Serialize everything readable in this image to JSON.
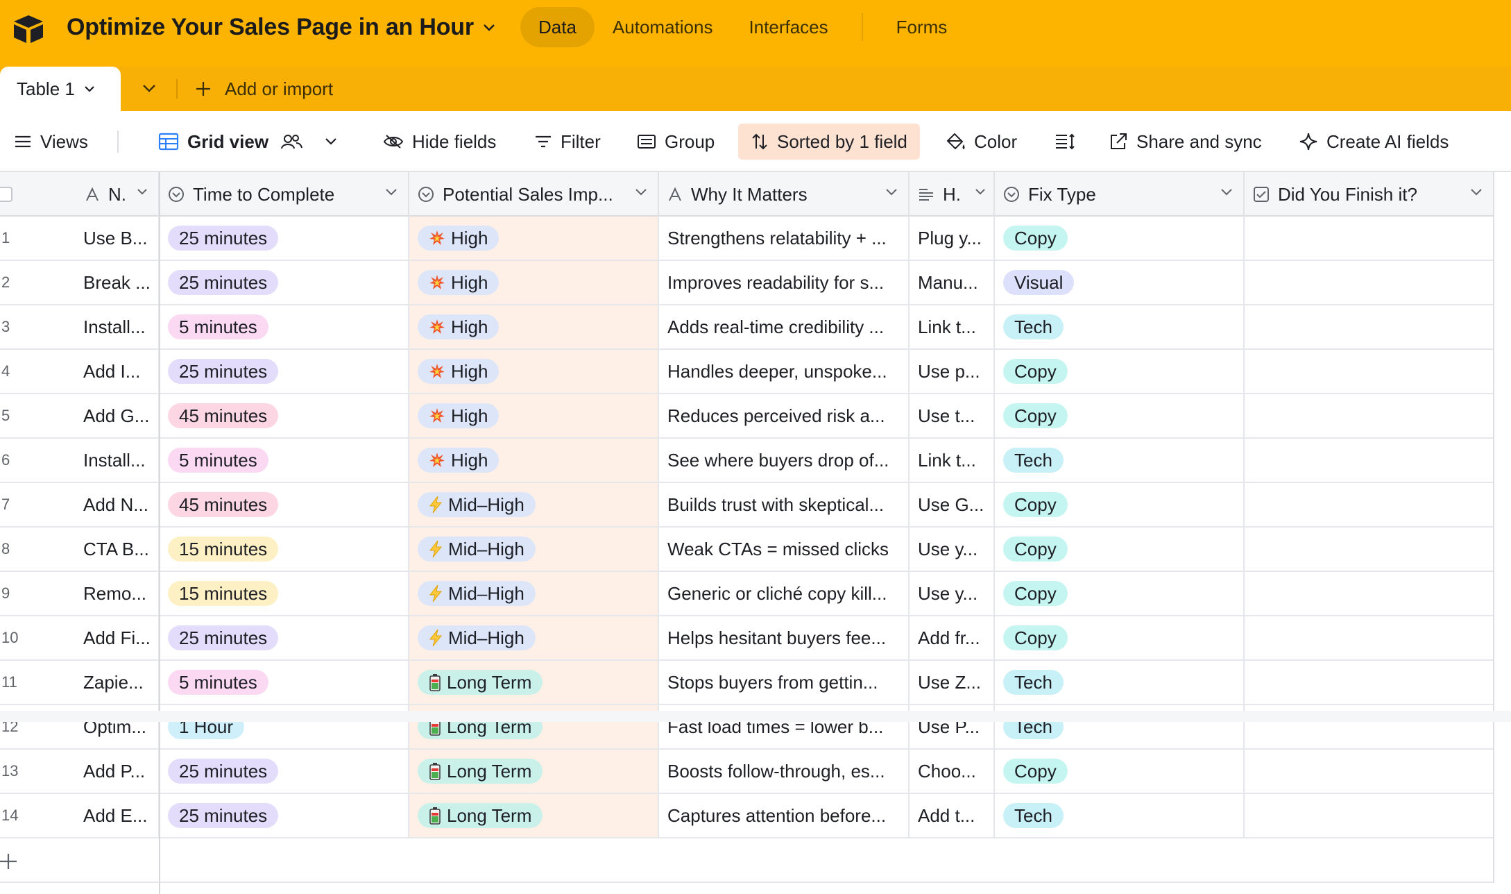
{
  "app": {
    "base_title": "Optimize Your Sales Page in an Hour",
    "brand_color": "#fcb400",
    "nav": [
      {
        "label": "Data",
        "active": true
      },
      {
        "label": "Automations",
        "active": false
      },
      {
        "label": "Interfaces",
        "active": false
      },
      {
        "label": "Forms",
        "active": false
      }
    ]
  },
  "tabs": {
    "active_table": "Table 1",
    "add_import": "Add or import"
  },
  "toolbar": {
    "views": "Views",
    "grid_view": "Grid view",
    "hide_fields": "Hide fields",
    "filter": "Filter",
    "group": "Group",
    "sorted": "Sorted by 1 field",
    "color": "Color",
    "share_sync": "Share and sync",
    "create_ai": "Create AI fields"
  },
  "columns": [
    {
      "label": "N.",
      "icon": "text-field-icon"
    },
    {
      "label": "Time to Complete",
      "icon": "single-select-icon"
    },
    {
      "label": "Potential Sales Imp...",
      "icon": "single-select-icon"
    },
    {
      "label": "Why It Matters",
      "icon": "text-field-icon"
    },
    {
      "label": "H.",
      "icon": "long-text-icon"
    },
    {
      "label": "Fix Type",
      "icon": "single-select-icon"
    },
    {
      "label": "Did You Finish it?",
      "icon": "checkbox-icon"
    }
  ],
  "chip_colors": {
    "25 minutes": "#e3dcfb",
    "5 minutes": "#fbd9f3",
    "45 minutes": "#fdd6e3",
    "15 minutes": "#fdf0c4",
    "1 Hour": "#cff0fb",
    "High": "#dde6f9",
    "Mid–High": "#dde6f9",
    "Long Term": "#c9f1ea",
    "Copy": "#c5f5f0",
    "Visual": "#dde0fb",
    "Tech": "#c8f0f7"
  },
  "rows": [
    {
      "num": "1",
      "name": "Use B...",
      "time": "25 minutes",
      "impact": "High",
      "impact_icon": "collision-icon",
      "why": "Strengthens relatability + ...",
      "how": "Plug y...",
      "fix": "Copy"
    },
    {
      "num": "2",
      "name": "Break ...",
      "time": "25 minutes",
      "impact": "High",
      "impact_icon": "collision-icon",
      "why": "Improves readability for s...",
      "how": "Manu...",
      "fix": "Visual"
    },
    {
      "num": "3",
      "name": "Install...",
      "time": "5 minutes",
      "impact": "High",
      "impact_icon": "collision-icon",
      "why": "Adds real-time credibility ...",
      "how": "Link t...",
      "fix": "Tech"
    },
    {
      "num": "4",
      "name": "Add I...",
      "time": "25 minutes",
      "impact": "High",
      "impact_icon": "collision-icon",
      "why": "Handles deeper, unspoke...",
      "how": "Use p...",
      "fix": "Copy"
    },
    {
      "num": "5",
      "name": "Add G...",
      "time": "45 minutes",
      "impact": "High",
      "impact_icon": "collision-icon",
      "why": "Reduces perceived risk a...",
      "how": "Use t...",
      "fix": "Copy"
    },
    {
      "num": "6",
      "name": "Install...",
      "time": "5 minutes",
      "impact": "High",
      "impact_icon": "collision-icon",
      "why": "See where buyers drop of...",
      "how": "Link t...",
      "fix": "Tech"
    },
    {
      "num": "7",
      "name": "Add N...",
      "time": "45 minutes",
      "impact": "Mid–High",
      "impact_icon": "lightning-icon",
      "why": "Builds trust with skeptical...",
      "how": "Use G...",
      "fix": "Copy"
    },
    {
      "num": "8",
      "name": "CTA B...",
      "time": "15 minutes",
      "impact": "Mid–High",
      "impact_icon": "lightning-icon",
      "why": "Weak CTAs = missed clicks",
      "how": "Use y...",
      "fix": "Copy"
    },
    {
      "num": "9",
      "name": "Remo...",
      "time": "15 minutes",
      "impact": "Mid–High",
      "impact_icon": "lightning-icon",
      "why": "Generic or cliché copy kill...",
      "how": "Use y...",
      "fix": "Copy"
    },
    {
      "num": "10",
      "name": "Add Fi...",
      "time": "25 minutes",
      "impact": "Mid–High",
      "impact_icon": "lightning-icon",
      "why": "Helps hesitant buyers fee...",
      "how": "Add fr...",
      "fix": "Copy"
    },
    {
      "num": "11",
      "name": "Zapie...",
      "time": "5 minutes",
      "impact": "Long Term",
      "impact_icon": "battery-icon",
      "why": "Stops buyers from gettin...",
      "how": "Use Z...",
      "fix": "Tech"
    },
    {
      "num": "12",
      "name": "Optim...",
      "time": "1 Hour",
      "impact": "Long Term",
      "impact_icon": "battery-icon",
      "why": "Fast load times = lower b...",
      "how": "Use P...",
      "fix": "Tech"
    },
    {
      "num": "13",
      "name": "Add P...",
      "time": "25 minutes",
      "impact": "Long Term",
      "impact_icon": "battery-icon",
      "why": "Boosts follow-through, es...",
      "how": "Choo...",
      "fix": "Copy"
    },
    {
      "num": "14",
      "name": "Add E...",
      "time": "25 minutes",
      "impact": "Long Term",
      "impact_icon": "battery-icon",
      "why": "Captures attention before...",
      "how": "Add t...",
      "fix": "Tech"
    }
  ]
}
